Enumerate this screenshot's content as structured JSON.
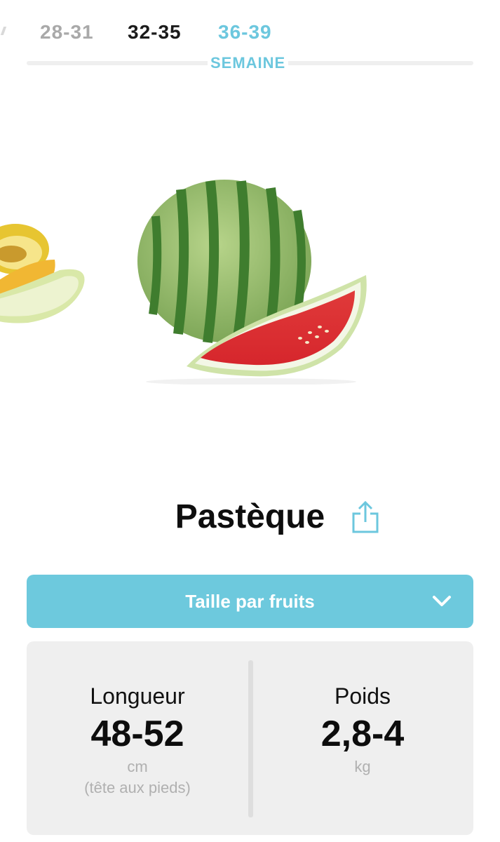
{
  "week_tabs": {
    "prev": "28-31",
    "mid": "32-35",
    "active": "36-39",
    "caption": "SEMAINE"
  },
  "fruit": {
    "name": "Pastèque",
    "image_icon": "watermelon-illustration",
    "side_image_icon": "honeydew-melon-illustration"
  },
  "dropdown": {
    "label": "Taille par fruits",
    "icon": "chevron-down-icon"
  },
  "stats": {
    "length": {
      "label": "Longueur",
      "value": "48-52",
      "unit": "cm",
      "note": "(tête aux pieds)"
    },
    "weight": {
      "label": "Poids",
      "value": "2,8-4",
      "unit": "kg"
    }
  },
  "colors": {
    "accent": "#6cc7de",
    "dropdown_bg": "#6dc9dd",
    "card_bg": "#efefef",
    "muted_text": "#b0b0b0"
  }
}
